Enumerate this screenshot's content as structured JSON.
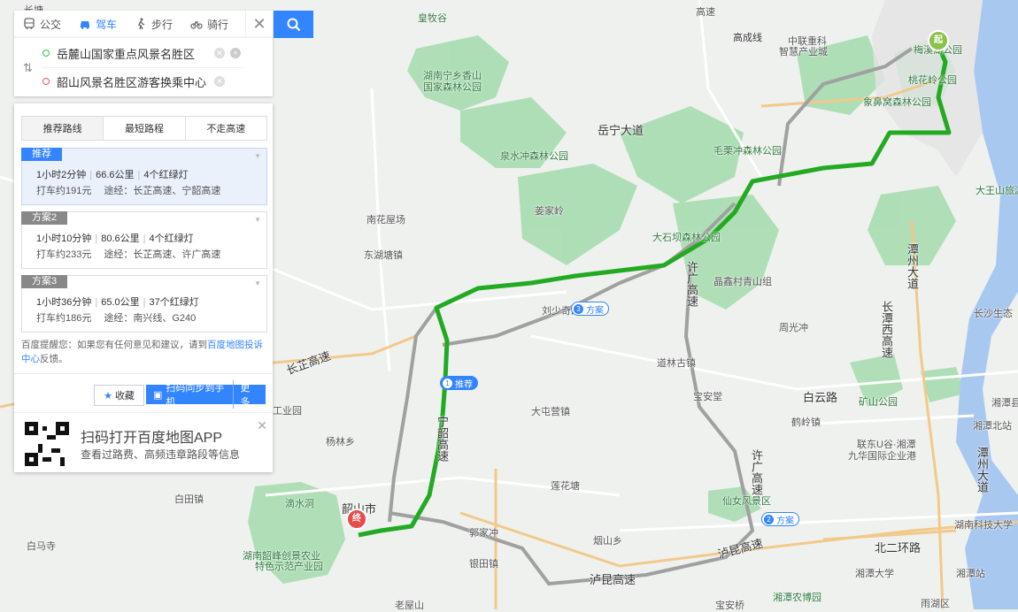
{
  "colors": {
    "accent": "#3385ff",
    "route": "#22aa22",
    "alt_route": "#aaaaaa",
    "park": "#9fd9a0",
    "water": "#a9c8f0"
  },
  "mode_tabs": [
    {
      "label": "公交",
      "icon": "bus-icon"
    },
    {
      "label": "驾车",
      "icon": "car-icon"
    },
    {
      "label": "步行",
      "icon": "walk-icon"
    },
    {
      "label": "骑行",
      "icon": "bike-icon"
    }
  ],
  "active_mode": "驾车",
  "route": {
    "start": "岳麓山国家重点风景名胜区",
    "end": "韶山风景名胜区游客换乘中心"
  },
  "route_tabs": [
    "推荐路线",
    "最短路程",
    "不走高速"
  ],
  "plans": [
    {
      "tag": "推荐",
      "time": "1小时2分钟",
      "distance": "66.6公里",
      "lights": "4个红绿灯",
      "taxi": "打车约191元",
      "via": "途经：长芷高速、宁韶高速"
    },
    {
      "tag": "方案2",
      "time": "1小时10分钟",
      "distance": "80.6公里",
      "lights": "4个红绿灯",
      "taxi": "打车约233元",
      "via": "途经：长芷高速、许广高速"
    },
    {
      "tag": "方案3",
      "time": "1小时36分钟",
      "distance": "65.0公里",
      "lights": "37个红绿灯",
      "taxi": "打车约186元",
      "via": "途经：南兴线、G240"
    }
  ],
  "tip": {
    "prefix": "百度提醒您：如果您有任何意见和建议，请到",
    "link": "百度地图投诉中心",
    "suffix": "反馈。"
  },
  "actions": {
    "favorite": "收藏",
    "scan": "扫码同步到手机",
    "more": "更多"
  },
  "promo": {
    "title": "扫码打开百度地图APP",
    "subtitle": "查看过路费、高频违章路段等信息"
  },
  "markers": {
    "start": "起",
    "end": "终"
  },
  "route_badges": {
    "main": "推荐",
    "alt2": "方案",
    "alt3": "方案",
    "main_n": "1",
    "alt2_n": "2",
    "alt3_n": "3"
  },
  "map_labels": {
    "l01": "长塘",
    "l02": "皇牧谷",
    "l03": "高速",
    "l04": "高成线",
    "l05": "中联重科",
    "l06": "智慧产业城",
    "l07": "湖南宁乡香山",
    "l08": "国家森林公园",
    "l09": "梅溪湖公园",
    "l10": "桃花岭公园",
    "l11": "象鼻窝森林公园",
    "l12": "岳宁大道",
    "l13": "毛栗冲森林公园",
    "l14": "泉水冲森林公园",
    "l15": "姜家岭",
    "l16": "大石坝森林公园",
    "l17": "大王山旅游度假区",
    "l18": "南花屋场",
    "l19": "东湖塘镇",
    "l20": "潭州大道",
    "l21": "长沙生态",
    "l22": "许广高速",
    "l23": "晶鑫村青山组",
    "l24": "刘少奇故里",
    "l25": "长潭西高速",
    "l26": "周光冲",
    "l27": "长芷高速",
    "l28": "道林古镇",
    "l29": "宝安堂",
    "l30": "白云路",
    "l31": "矿山公园",
    "l32": "湘潭县",
    "l33": "工业园",
    "l34": "大屯营镇",
    "l35": "鹤岭镇",
    "l36": "湘潭北站",
    "l37": "宁韶高速",
    "l38": "杨林乡",
    "l39": "联东U谷·湘潭",
    "l40": "九华国际企业港",
    "l41": "许广高速",
    "l42": "潭州大道",
    "l43": "滴水洞",
    "l44": "韶山市",
    "l45": "白田镇",
    "l46": "莲花塘",
    "l47": "仙女风景区",
    "l48": "湖南科技大学",
    "l49": "白马寺",
    "l50": "湖南韶峰创景农业",
    "l51": "特色示范产业园",
    "l52": "银田镇",
    "l53": "烟山乡",
    "l54": "泸昆高速",
    "l55": "湘潭大学",
    "l56": "北二环路",
    "l57": "湘潭站",
    "l58": "湘潭农博园",
    "l59": "雨湖区",
    "l60": "老屋山",
    "l61": "宝安桥",
    "l62": "郭家冲",
    "l63": "高速"
  }
}
